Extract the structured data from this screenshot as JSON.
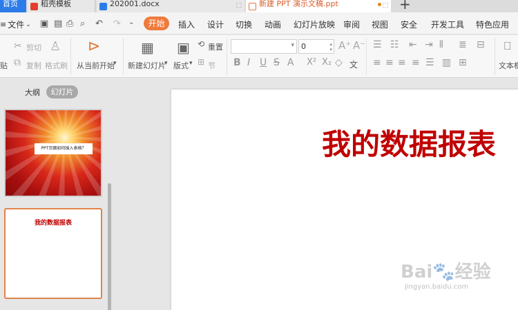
{
  "tabs": [
    {
      "label": "首页"
    },
    {
      "label": "稻壳模板"
    },
    {
      "label": "202001.docx"
    },
    {
      "label": "新建 PPT 演示文稿.ppt"
    }
  ],
  "menu": {
    "file_label": "文件",
    "start_label": "开始",
    "items": [
      "插入",
      "设计",
      "切换",
      "动画",
      "幻灯片放映",
      "审阅",
      "视图",
      "安全",
      "开发工具",
      "特色应用"
    ]
  },
  "ribbon": {
    "paste_label": "贴",
    "cut_label": "剪切",
    "copy_label": "复制",
    "format_painter_label": "格式刷",
    "play_from_current_label": "从当前开始",
    "new_slide_label": "新建幻灯片",
    "layout_label": "版式",
    "reset_label": "重置",
    "section_label": "节",
    "font_size_value": "0",
    "textbox_label": "文本框",
    "wen_label": "文"
  },
  "left_pane": {
    "outline_label": "大纲",
    "slides_label": "幻灯片",
    "thumb1_text": "PPT页面如何插入表格？",
    "thumb2_text": "我的数据报表"
  },
  "slide": {
    "title": "我的数据报表"
  },
  "watermark": {
    "main": "Bai",
    "main2": "经验",
    "sub": "jingyan.baidu.com"
  },
  "colors": {
    "accent": "#ef7a3c",
    "title_red": "#c00000",
    "tab_blue": "#2b7ce9"
  }
}
